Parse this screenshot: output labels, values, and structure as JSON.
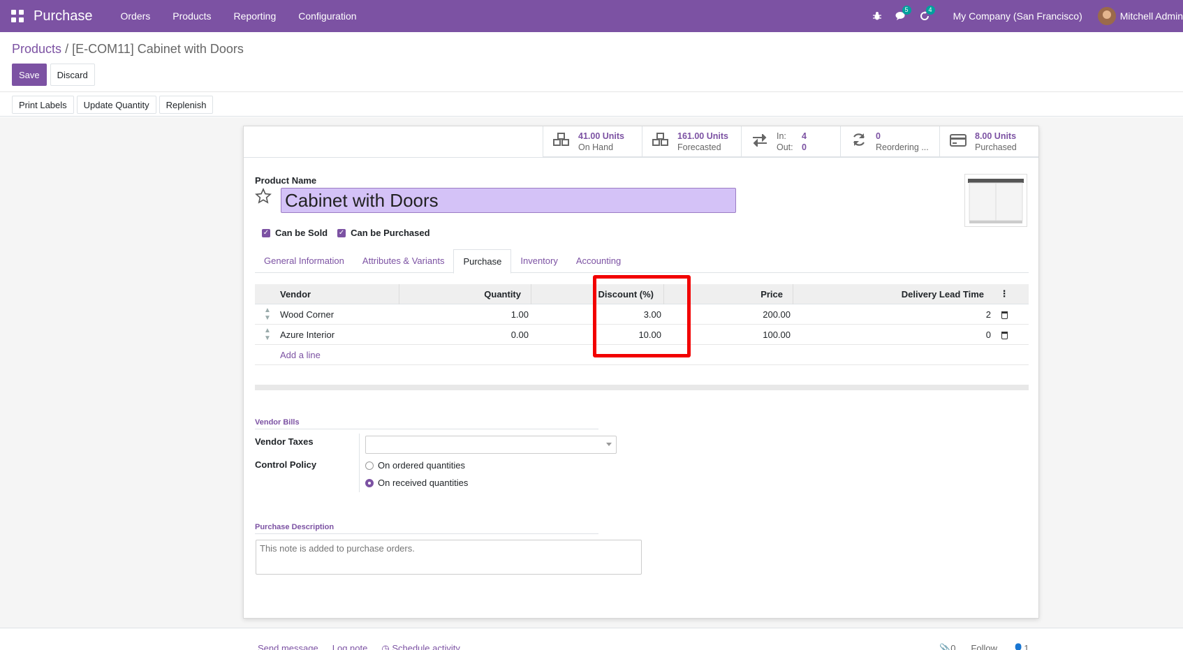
{
  "navbar": {
    "app_name": "Purchase",
    "menu": [
      "Orders",
      "Products",
      "Reporting",
      "Configuration"
    ],
    "messages_count": "5",
    "activities_count": "4",
    "company": "My Company (San Francisco)",
    "user": "Mitchell Admin"
  },
  "breadcrumb": {
    "parent": "Products",
    "separator": "/",
    "current": "[E-COM11] Cabinet with Doors"
  },
  "buttons": {
    "save": "Save",
    "discard": "Discard",
    "print_labels": "Print Labels",
    "update_quantity": "Update Quantity",
    "replenish": "Replenish"
  },
  "smart_buttons": {
    "on_hand": {
      "value": "41.00 Units",
      "label": "On Hand"
    },
    "forecasted": {
      "value": "161.00 Units",
      "label": "Forecasted"
    },
    "in_out": {
      "in_label": "In:",
      "in_value": "4",
      "out_label": "Out:",
      "out_value": "0"
    },
    "reordering": {
      "value": "0",
      "label": "Reordering ..."
    },
    "purchased": {
      "value": "8.00 Units",
      "label": "Purchased"
    }
  },
  "product": {
    "name_label": "Product Name",
    "name": "Cabinet with Doors",
    "can_be_sold": "Can be Sold",
    "can_be_purchased": "Can be Purchased"
  },
  "tabs": [
    "General Information",
    "Attributes & Variants",
    "Purchase",
    "Inventory",
    "Accounting"
  ],
  "vendor_table": {
    "headers": {
      "vendor": "Vendor",
      "quantity": "Quantity",
      "discount": "Discount (%)",
      "price": "Price",
      "lead_time": "Delivery Lead Time"
    },
    "rows": [
      {
        "vendor": "Wood Corner",
        "quantity": "1.00",
        "discount": "3.00",
        "price": "200.00",
        "lead_time": "2"
      },
      {
        "vendor": "Azure Interior",
        "quantity": "0.00",
        "discount": "10.00",
        "price": "100.00",
        "lead_time": "0"
      }
    ],
    "add_line": "Add a line"
  },
  "vendor_bills": {
    "title": "Vendor Bills",
    "taxes_label": "Vendor Taxes",
    "control_policy_label": "Control Policy",
    "option_ordered": "On ordered quantities",
    "option_received": "On received quantities",
    "selected": "On received quantities"
  },
  "purchase_description": {
    "title": "Purchase Description",
    "placeholder": "This note is added to purchase orders."
  },
  "chatter": {
    "send_message": "Send message",
    "log_note": "Log note",
    "schedule_activity": "Schedule activity",
    "attachments": "0",
    "follow": "Follow",
    "followers": "1"
  },
  "colors": {
    "brand": "#7c52a3",
    "highlight": "#f20000",
    "name_input_bg": "#d4c2f7"
  }
}
